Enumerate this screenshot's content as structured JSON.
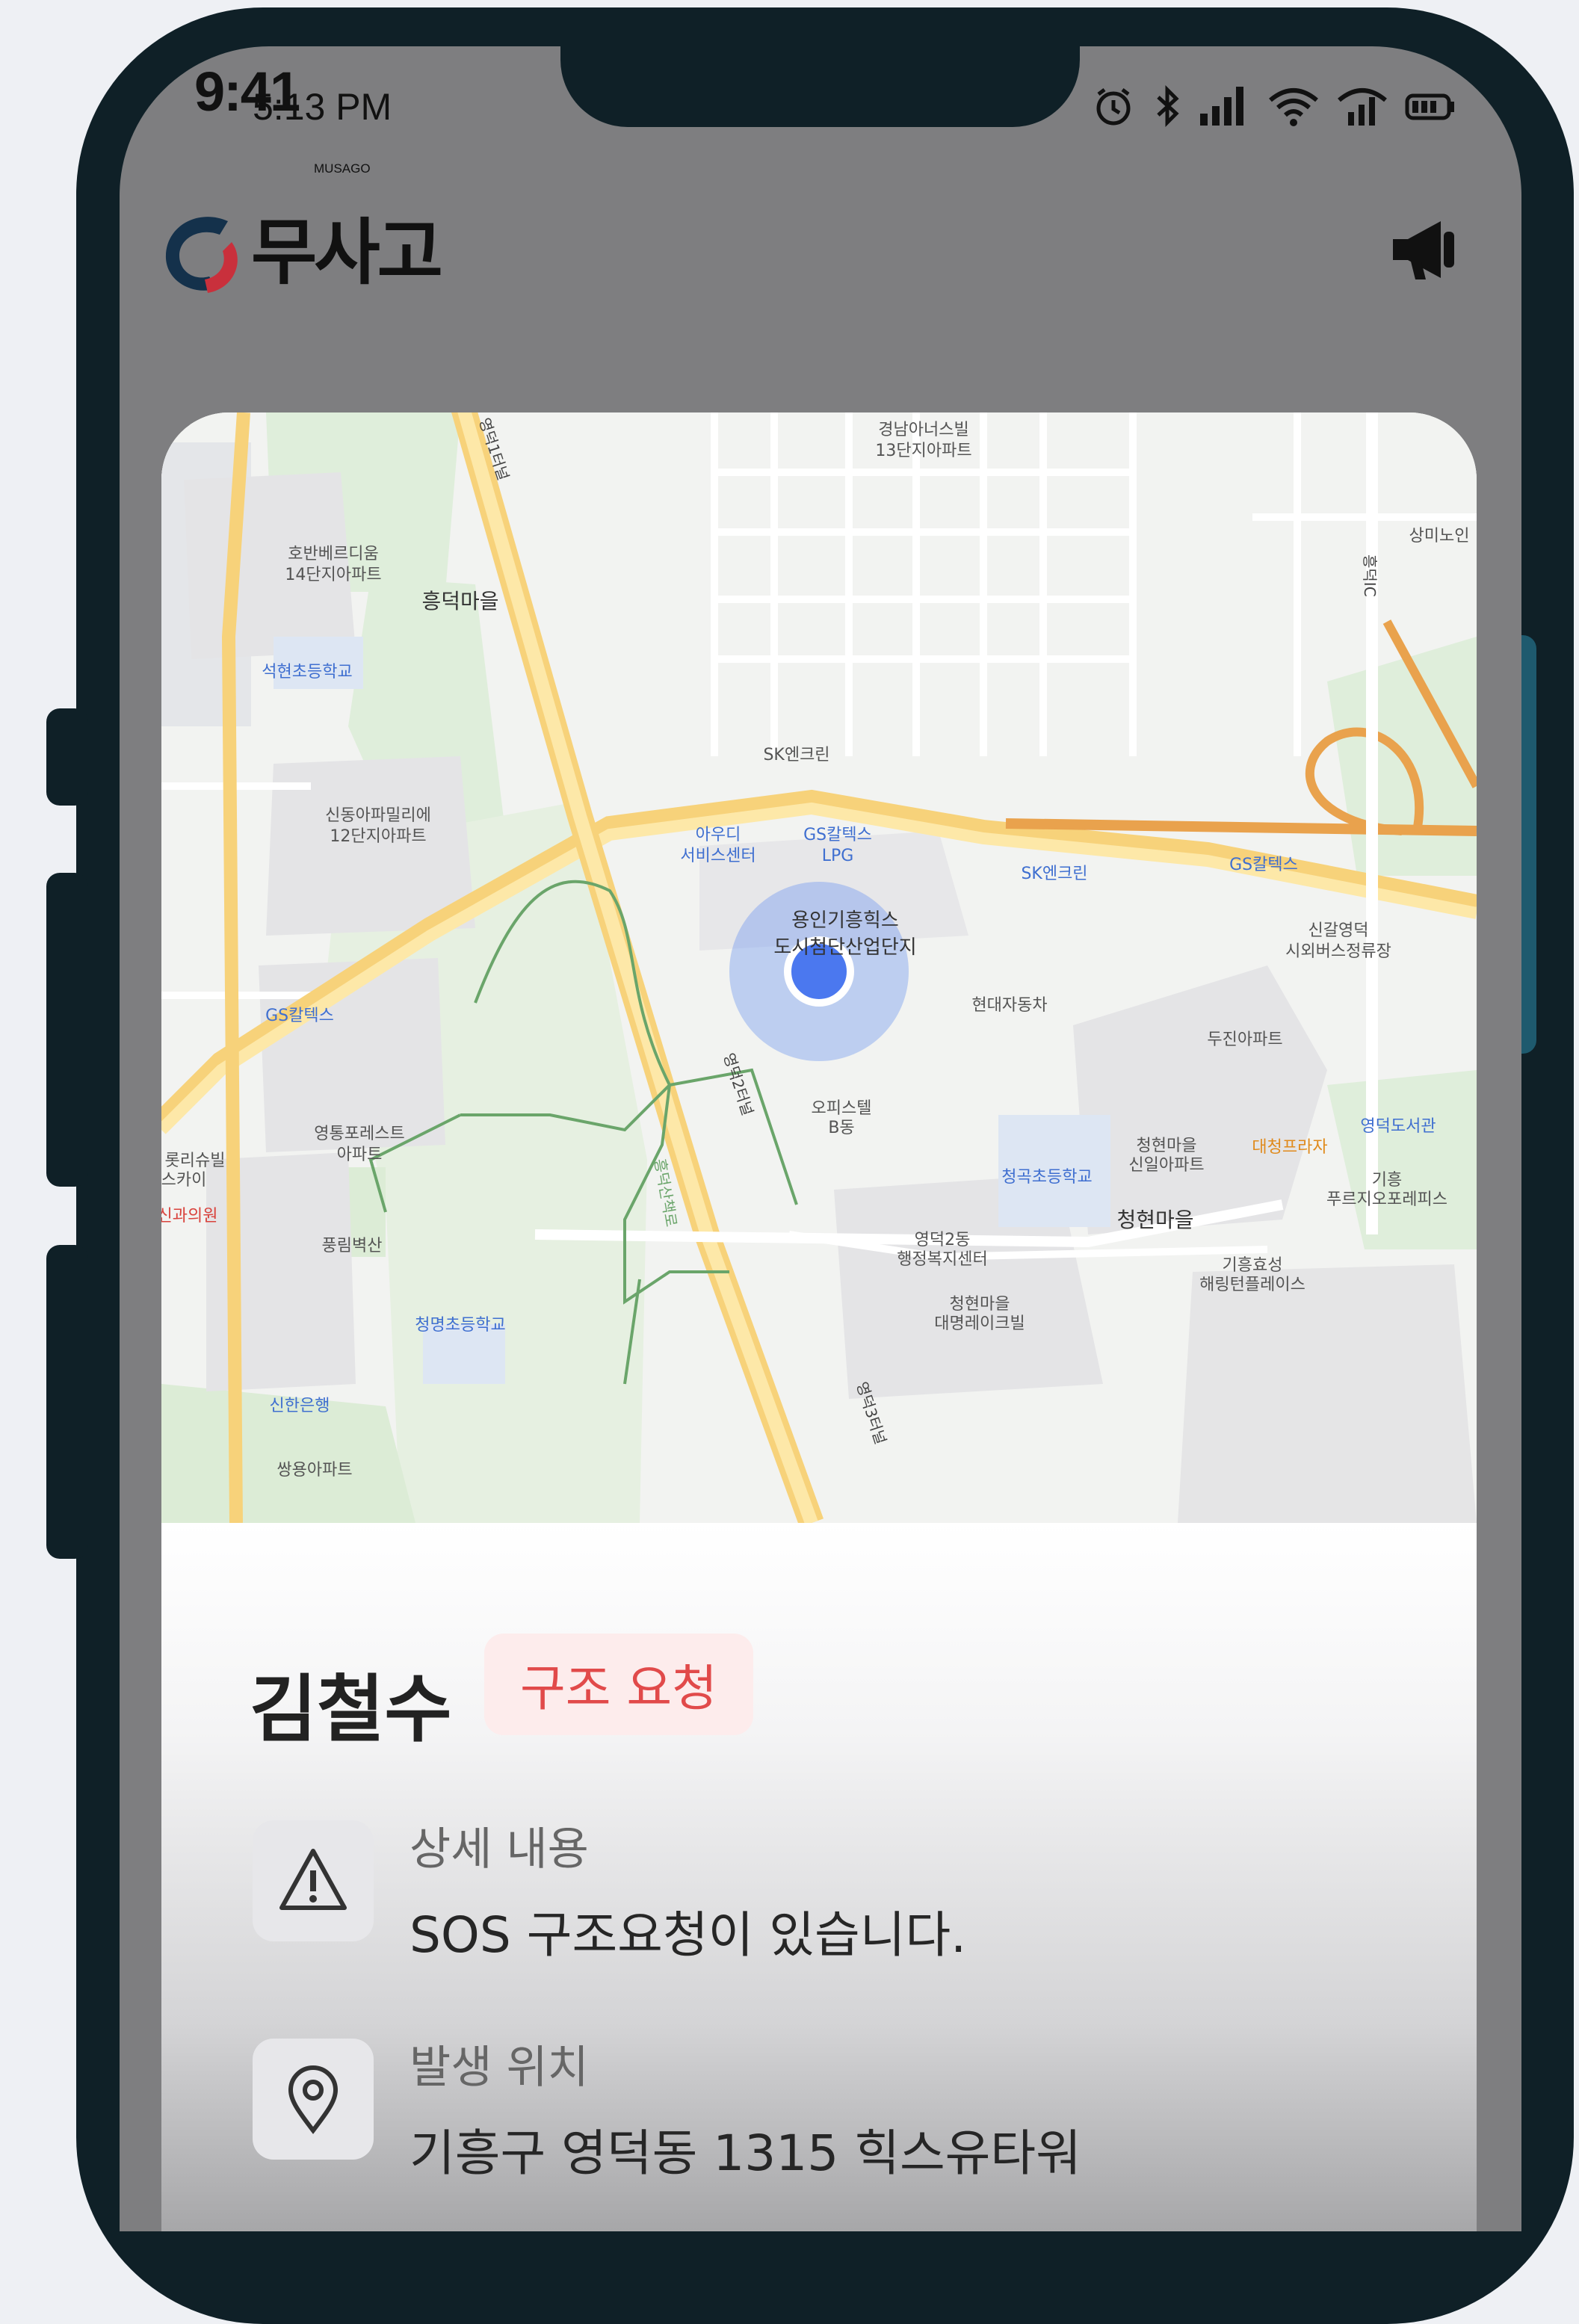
{
  "status_bar": {
    "overlay_clock": "9:41",
    "time": "5:13 PM",
    "icons": [
      "alarm-icon",
      "bluetooth-icon",
      "cell-signal-icon",
      "wifi-icon",
      "cell-signal-icon",
      "battery-icon"
    ]
  },
  "app": {
    "logo_text": "무사고",
    "logo_subtext": "MUSAGO",
    "action_icon": "megaphone-icon"
  },
  "map": {
    "place_labels": [
      "경남아너스빌",
      "13단지아파트",
      "상미노인",
      "호반베르디움",
      "14단지아파트",
      "흥덕마을",
      "석현초등학교",
      "SK엔크린",
      "신동아파밀리에",
      "12단지아파트",
      "아우디",
      "서비스센터",
      "GS칼텍스",
      "LPG",
      "SK엔크린",
      "GS칼텍스",
      "용인기흥힉스",
      "도시첨단산업단지",
      "신갈영덕",
      "시외버스정류장",
      "GS칼텍스",
      "현대자동차",
      "두진아파트",
      "오피스텔",
      "B동",
      "영통포레스트",
      "아파트",
      "청현마을",
      "신일아파트",
      "대청프라자",
      "영덕도서관",
      "풍림벽산",
      "청곡초등학교",
      "기흥",
      "푸르지오포레피스",
      "영덕2동",
      "행정복지센터",
      "청현마을",
      "기흥효성",
      "해링턴플레이스",
      "청명초등학교",
      "청현마을",
      "대명레이크빌",
      "신한은행",
      "쌍용아파트",
      "롯리슈빌",
      "스카이",
      "신과의원"
    ],
    "road_labels": [
      "영덕1터널",
      "영덕2터널",
      "영덕3터널",
      "흥덕IC",
      "흥덕산책로"
    ]
  },
  "incident": {
    "name": "김철수",
    "status_badge": "구조 요청",
    "details": [
      {
        "icon": "warning-icon",
        "label": "상세 내용",
        "value": "SOS 구조요청이 있습니다."
      },
      {
        "icon": "location-pin-icon",
        "label": "발생 위치",
        "value": "기흥구 영덕동 1315 힉스유타워"
      }
    ]
  }
}
